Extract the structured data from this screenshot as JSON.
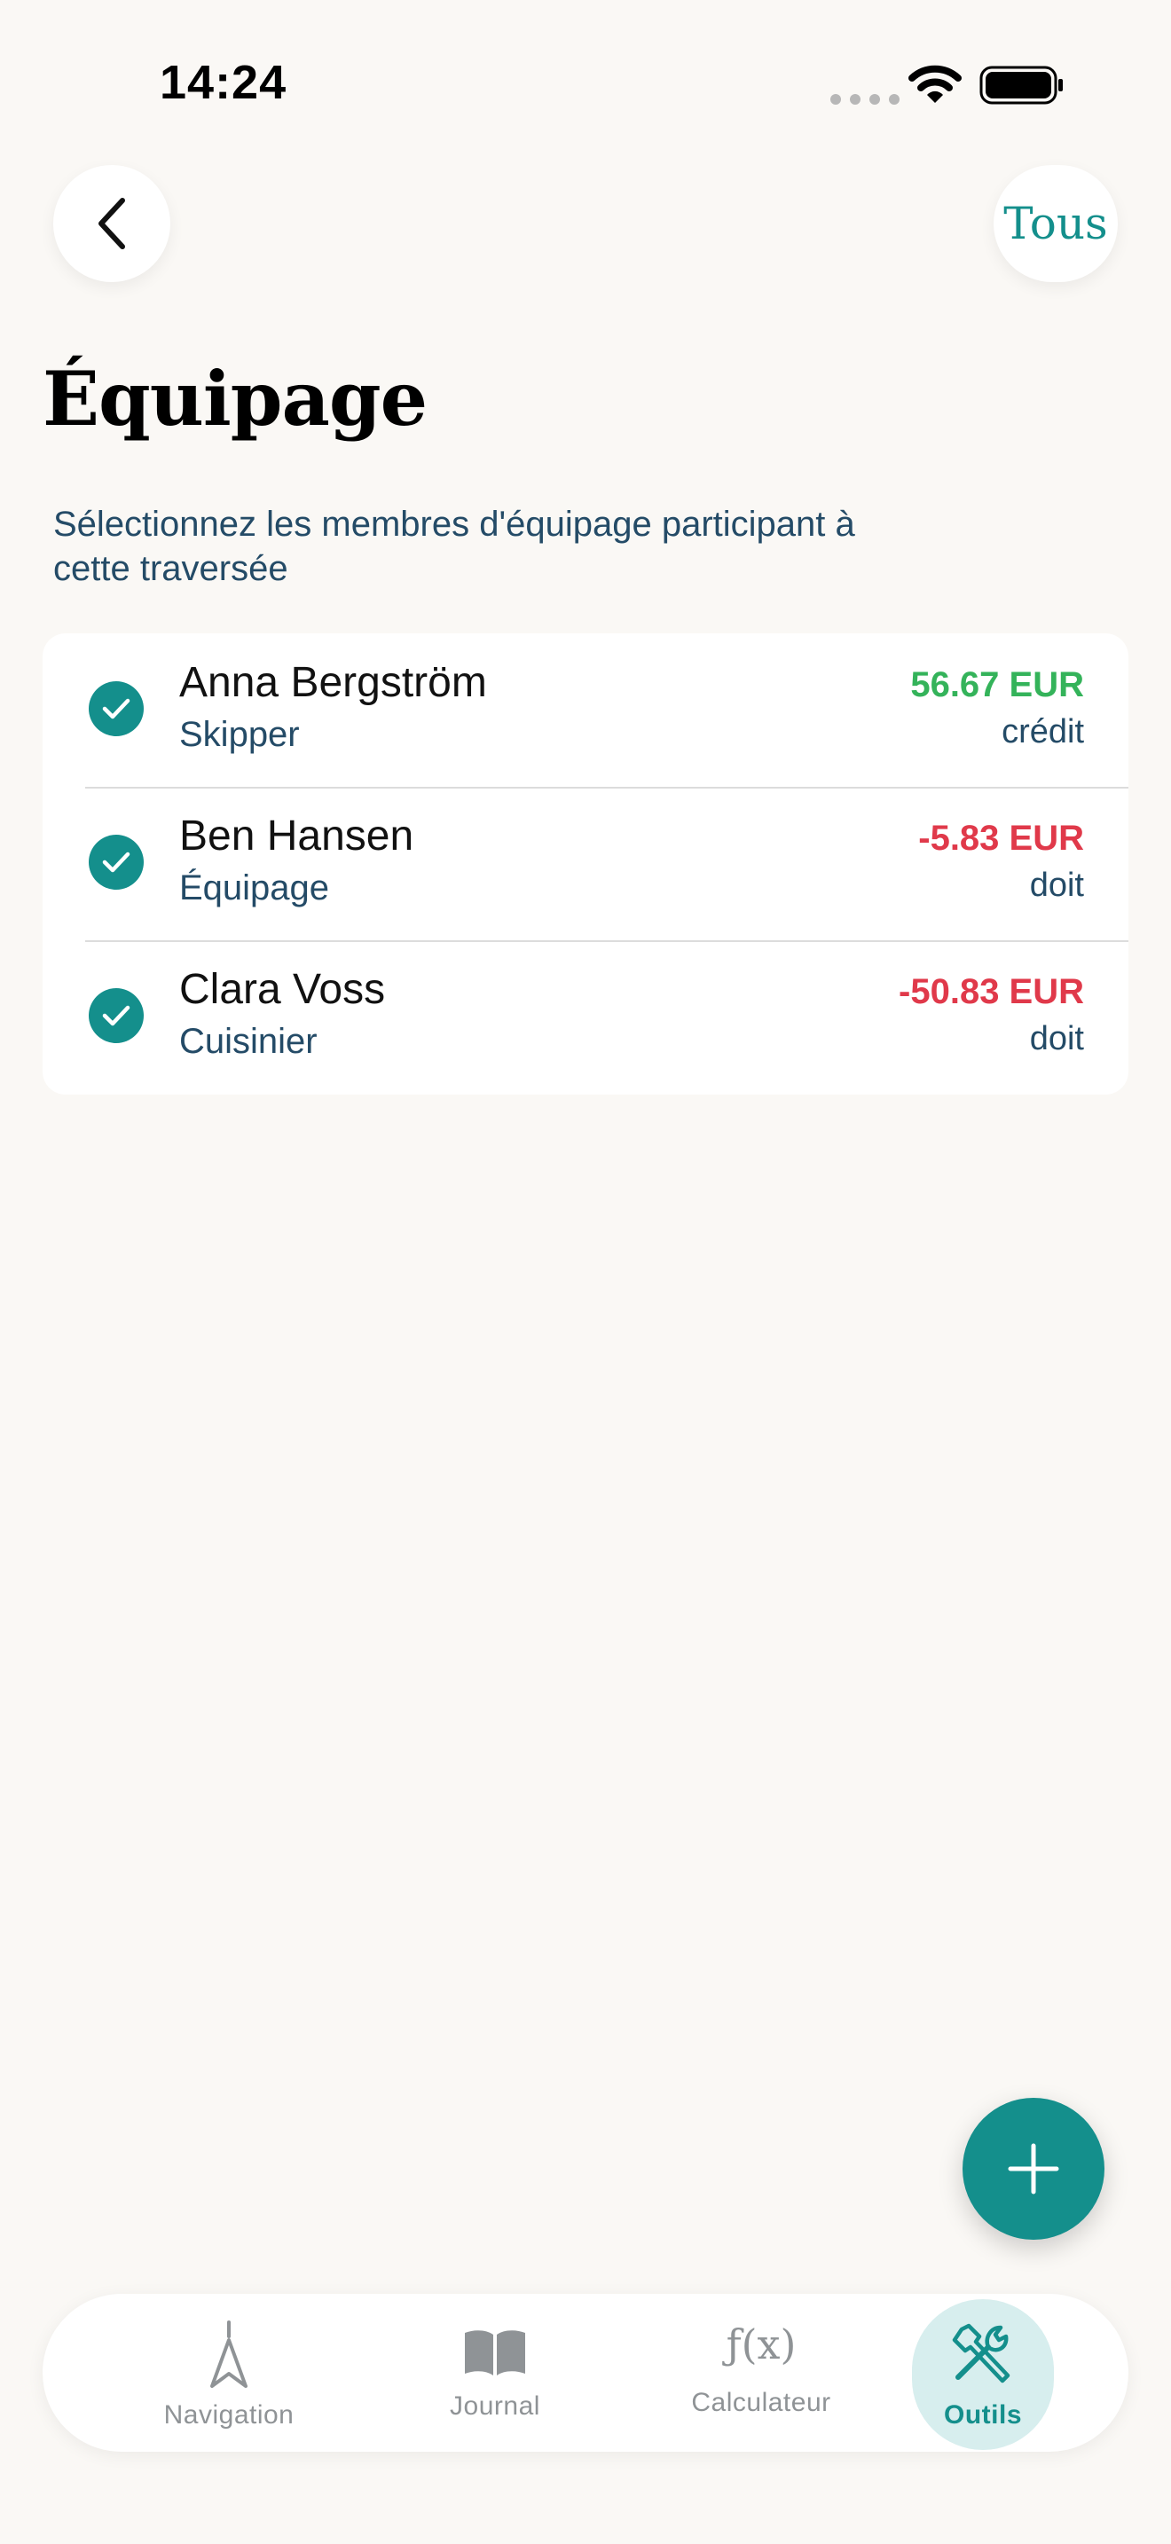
{
  "status_bar": {
    "time": "14:24"
  },
  "header": {
    "back_icon": "chevron-left-icon",
    "all_button_label": "Tous"
  },
  "page": {
    "title": "Équipage",
    "subtitle": "Sélectionnez les membres d'équipage participant à cette traversée"
  },
  "crew": [
    {
      "name": "Anna Bergström",
      "role": "Skipper",
      "amount": "56.67 EUR",
      "status": "crédit",
      "amount_color": "#34b35a",
      "selected": true
    },
    {
      "name": "Ben Hansen",
      "role": "Équipage",
      "amount": "-5.83 EUR",
      "status": "doit",
      "amount_color": "#e0394a",
      "selected": true
    },
    {
      "name": "Clara Voss",
      "role": "Cuisinier",
      "amount": "-50.83 EUR",
      "status": "doit",
      "amount_color": "#e0394a",
      "selected": true
    }
  ],
  "fab": {
    "icon": "plus-icon"
  },
  "tabs": [
    {
      "label": "Navigation",
      "icon": "compass-arrow-icon",
      "active": false
    },
    {
      "label": "Journal",
      "icon": "book-icon",
      "active": false
    },
    {
      "label": "Calculateur",
      "icon": "function-icon",
      "active": false
    },
    {
      "label": "Outils",
      "icon": "tools-icon",
      "active": true
    }
  ],
  "colors": {
    "accent": "#148f8c",
    "background": "#faf8f5",
    "credit": "#34b35a",
    "debt": "#e0394a",
    "secondary_text": "#244b67"
  }
}
